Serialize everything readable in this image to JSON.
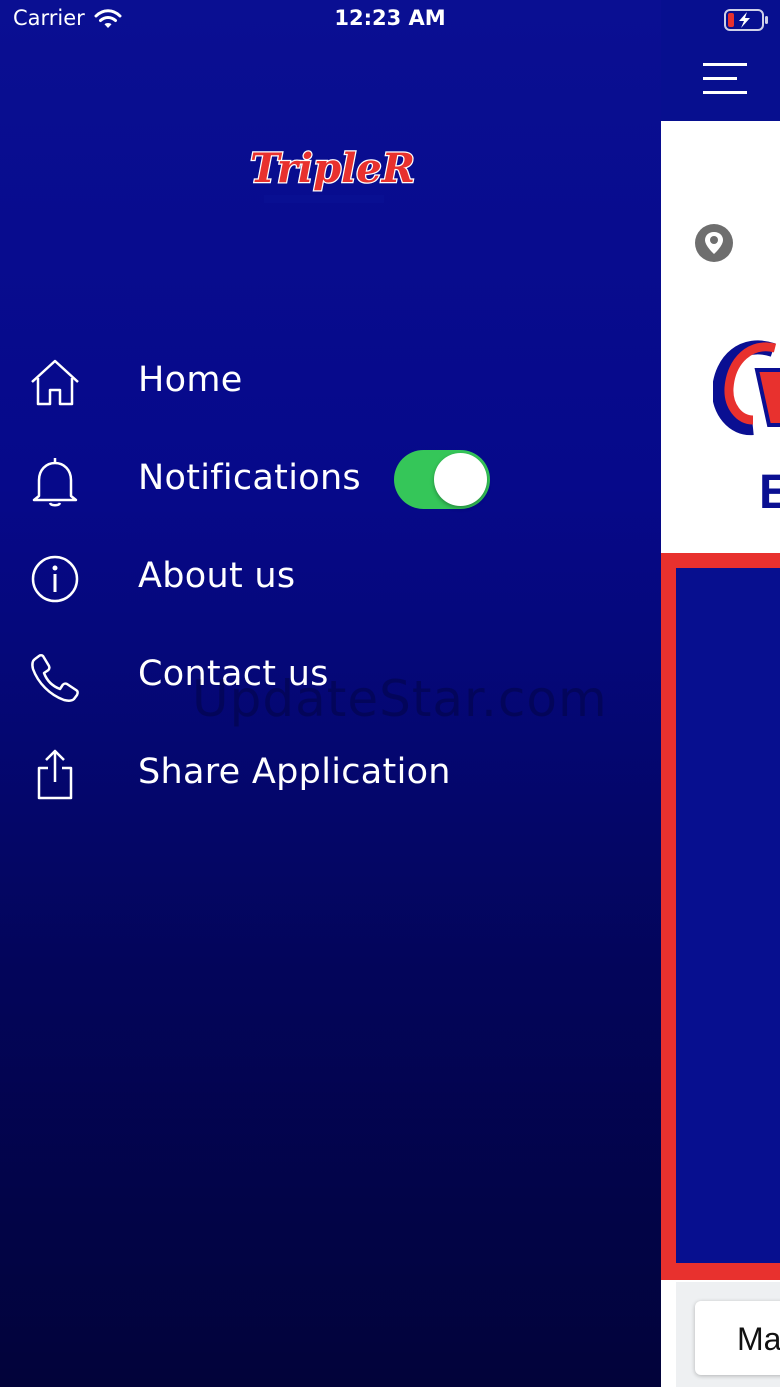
{
  "status_bar": {
    "carrier": "Carrier",
    "time": "12:23 AM",
    "wifi_icon": "wifi-icon",
    "battery_icon": "battery-charging-icon"
  },
  "brand": {
    "logo_text": "TripleR",
    "colors": {
      "red": "#e8312e",
      "blue": "#0a0f92"
    }
  },
  "menu": {
    "items": [
      {
        "label": "Home",
        "icon": "home-icon"
      },
      {
        "label": "Notifications",
        "icon": "bell-icon",
        "toggle_on": true
      },
      {
        "label": "About us",
        "icon": "info-icon"
      },
      {
        "label": "Contact us",
        "icon": "phone-icon"
      },
      {
        "label": "Share Application",
        "icon": "share-icon"
      }
    ]
  },
  "watermark": "UpdateStar.com",
  "main": {
    "menu_icon": "hamburger-menu-icon",
    "location_icon": "location-pin-icon",
    "map_label_partial": "Ma"
  },
  "colors": {
    "drawer_top": "#0a0f92",
    "drawer_bottom": "#02033a",
    "toggle_on": "#35c659",
    "frame_red": "#e8312e"
  }
}
